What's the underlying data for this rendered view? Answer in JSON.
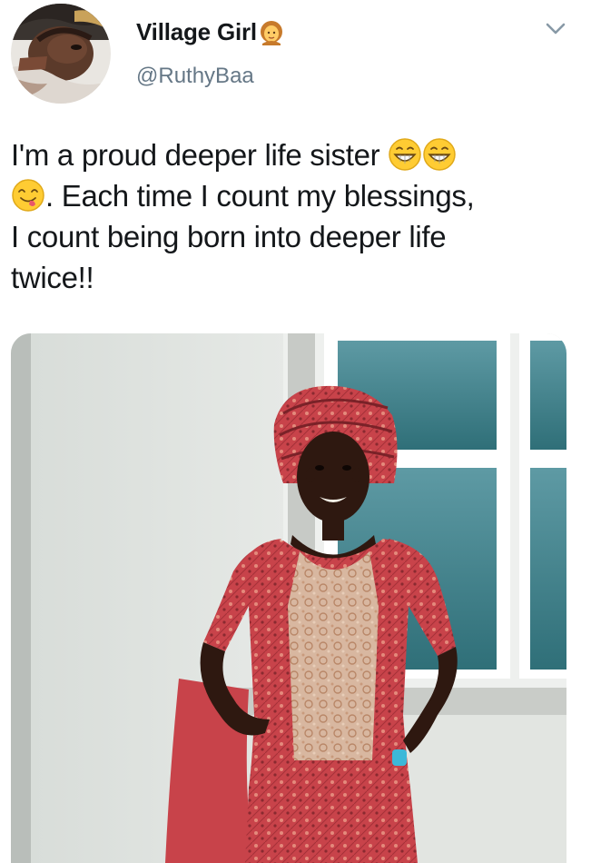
{
  "tweet": {
    "display_name": "Village Girl",
    "handle": "@RuthyBaa",
    "lines": [
      {
        "text_before": "I'm a proud deeper life sister",
        "text_after": ""
      },
      {
        "text_before": "",
        "text_after": ". Each time I count my blessings,"
      },
      {
        "text_before": "I count being born into deeper life",
        "text_after": ""
      },
      {
        "text_before": "twice!!",
        "text_after": ""
      }
    ],
    "icons": {
      "name_emoji": "woman-emoji-icon",
      "line1_emojis": [
        "grinning-face-icon",
        "grinning-face-icon"
      ],
      "line2_emoji": "face-savoring-food-icon",
      "menu": "chevron-down-icon"
    }
  },
  "colors": {
    "text": "#14171a",
    "secondary": "#657786",
    "emoji_yellow": "#ffcc33",
    "emoji_outline": "#e0a91a"
  }
}
